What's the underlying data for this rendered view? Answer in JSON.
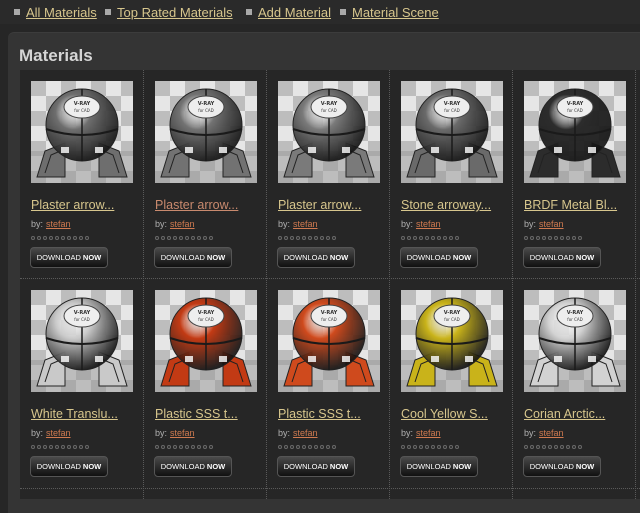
{
  "nav": [
    {
      "label": "All Materials"
    },
    {
      "label": "Top Rated Materials"
    },
    {
      "label": "Add Material"
    },
    {
      "label": "Material Scene"
    }
  ],
  "section_title": "Materials",
  "by_label": "by:",
  "download": {
    "label": "DOWNLOAD",
    "emphasis": "NOW"
  },
  "render_logo": "V-RAY for CAD",
  "materials": [
    {
      "title": "Plaster arrow...",
      "author": "stefan",
      "ball_color": "#6e6e6e",
      "visited": false,
      "rating": 0
    },
    {
      "title": "Plaster arrow...",
      "author": "stefan",
      "ball_color": "#727272",
      "visited": true,
      "rating": 0
    },
    {
      "title": "Plaster arrow...",
      "author": "stefan",
      "ball_color": "#7a7a7a",
      "visited": false,
      "rating": 0
    },
    {
      "title": "Stone arroway...",
      "author": "stefan",
      "ball_color": "#6a6a6a",
      "visited": false,
      "rating": 0
    },
    {
      "title": "BRDF Metal Bl...",
      "author": "stefan",
      "ball_color": "#2c2c2c",
      "visited": false,
      "rating": 0
    },
    {
      "title": "White Translu...",
      "author": "stefan",
      "ball_color": "#c9c9c9",
      "visited": false,
      "rating": 0
    },
    {
      "title": "Plastic SSS t...",
      "author": "stefan",
      "ball_color": "#c23a14",
      "visited": false,
      "rating": 0
    },
    {
      "title": "Plastic SSS t...",
      "author": "stefan",
      "ball_color": "#cf4a1d",
      "visited": false,
      "rating": 0
    },
    {
      "title": "Cool Yellow S...",
      "author": "stefan",
      "ball_color": "#c9b31a",
      "visited": false,
      "rating": 0
    },
    {
      "title": "Corian Arctic...",
      "author": "stefan",
      "ball_color": "#d2d2d2",
      "visited": false,
      "rating": 0
    }
  ]
}
